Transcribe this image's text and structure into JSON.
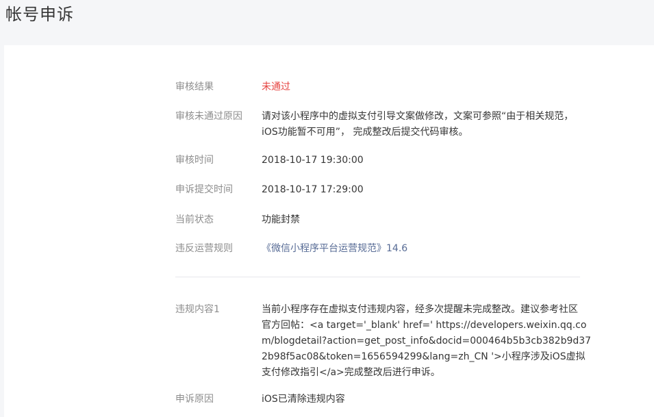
{
  "page": {
    "title": "帐号申诉"
  },
  "details": {
    "result_label": "审核结果",
    "result_value": "未通过",
    "reason_label": "审核未通过原因",
    "reason_line1": "请对该小程序中的虚拟支付引导文案做修改，文案可参照“由于相关规范，",
    "reason_line2": "iOS功能暂不可用”， 完成整改后提交代码审核。",
    "review_time_label": "审核时间",
    "review_time_value": "2018-10-17 19:30:00",
    "submit_time_label": "申诉提交时间",
    "submit_time_value": "2018-10-17 17:29:00",
    "status_label": "当前状态",
    "status_value": "功能封禁",
    "rule_label": "违反运营规则",
    "rule_value": "《微信小程序平台运营规范》14.6"
  },
  "violation": {
    "content_label": "违规内容1",
    "content_lines": [
      "当前小程序存在虚拟支付违规内容，经多次提醒未完成整改。建议参考社区",
      "官方回帖：<a target='_blank' href=' https://developers.weixin.qq.co",
      "m/blogdetail?action=get_post_info&docid=000464b5b3cb382b9d37",
      "2b98f5ac08&token=1656594299&lang=zh_CN '>小程序涉及iOS虚拟",
      "支付修改指引</a>完成整改后进行申诉。"
    ],
    "appeal_reason_label": "申诉原因",
    "appeal_reason_value": "iOS已清除违规内容"
  },
  "colors": {
    "page_bg": "#f5f6f8",
    "card_bg": "#ffffff",
    "label": "#8d8d8d",
    "text": "#353535",
    "failed_red": "#e64340",
    "link_blue": "#576b95"
  }
}
